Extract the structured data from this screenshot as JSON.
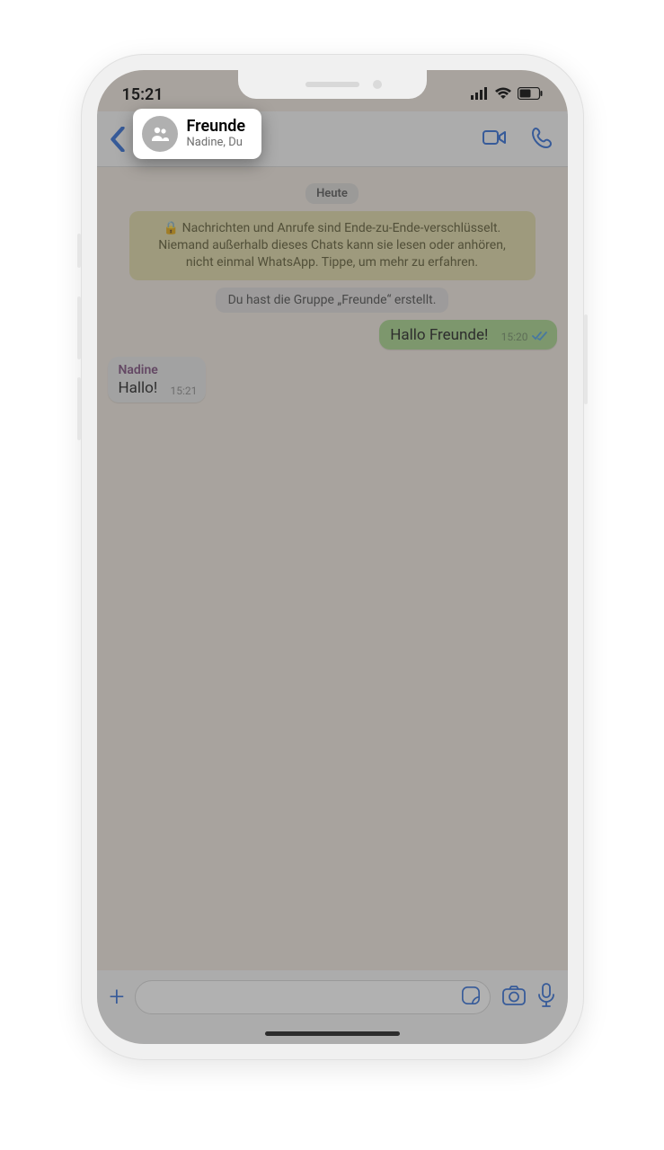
{
  "status": {
    "time": "15:21",
    "signal_icon": "signal-icon",
    "wifi_icon": "wifi-icon",
    "battery_icon": "battery-icon"
  },
  "header": {
    "group_name": "Freunde",
    "members": "Nadine, Du"
  },
  "chat": {
    "date_label": "Heute",
    "encryption_notice": "Nachrichten und Anrufe sind Ende-zu-Ende-verschlüsselt. Niemand außerhalb dieses Chats kann sie lesen oder anhören, nicht einmal WhatsApp. Tippe, um mehr zu erfahren.",
    "system_msg": "Du hast die Gruppe „Freunde“ erstellt.",
    "messages": [
      {
        "direction": "out",
        "sender": null,
        "text": "Hallo Freunde!",
        "time": "15:20",
        "status": "read"
      },
      {
        "direction": "in",
        "sender": "Nadine",
        "text": "Hallo!",
        "time": "15:21",
        "status": null
      }
    ]
  },
  "input": {
    "placeholder": ""
  }
}
